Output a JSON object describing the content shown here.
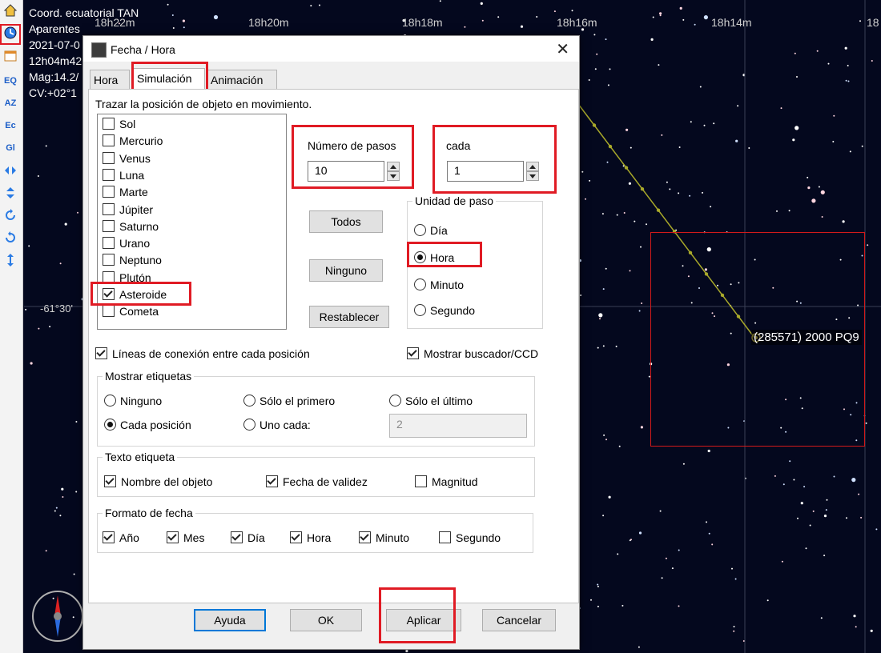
{
  "sky": {
    "info_lines": [
      "Coord. ecuatorial TAN",
      "Aparentes",
      "2021-07-0",
      "12h04m42",
      "Mag:14.2/",
      "CV:+02°1"
    ],
    "ra_labels": [
      "18h22m",
      "18h20m",
      "18h18m",
      "18h16m",
      "18h14m",
      "18"
    ],
    "dec_label": "-61°30'",
    "target_label": "(285571) 2000 PQ9"
  },
  "toolbar": {
    "buttons": [
      "EQ",
      "AZ",
      "Ec",
      "Gl"
    ]
  },
  "dialog": {
    "title": "Fecha / Hora",
    "close_symbol": "✕",
    "tabs": [
      "Hora",
      "Simulación",
      "Animación"
    ],
    "instruction": "Trazar la posición de objeto en movimiento.",
    "objects": [
      {
        "label": "Sol",
        "checked": false
      },
      {
        "label": "Mercurio",
        "checked": false
      },
      {
        "label": "Venus",
        "checked": false
      },
      {
        "label": "Luna",
        "checked": false
      },
      {
        "label": "Marte",
        "checked": false
      },
      {
        "label": "Júpiter",
        "checked": false
      },
      {
        "label": "Saturno",
        "checked": false
      },
      {
        "label": "Urano",
        "checked": false
      },
      {
        "label": "Neptuno",
        "checked": false
      },
      {
        "label": "Plutón",
        "checked": false
      },
      {
        "label": "Asteroide",
        "checked": true
      },
      {
        "label": "Cometa",
        "checked": false
      }
    ],
    "steps_label": "Número de pasos",
    "steps_value": "10",
    "every_label": "cada",
    "every_value": "1",
    "btn_all": "Todos",
    "btn_none": "Ninguno",
    "btn_reset": "Restablecer",
    "unit_group": "Unidad de paso",
    "units": [
      {
        "label": "Día",
        "selected": false
      },
      {
        "label": "Hora",
        "selected": true
      },
      {
        "label": "Minuto",
        "selected": false
      },
      {
        "label": "Segundo",
        "selected": false
      }
    ],
    "connect_lines": "Líneas de conexión entre cada posición",
    "show_finder": "Mostrar buscador/CCD",
    "labels_group": "Mostrar etiquetas",
    "label_opts": [
      {
        "label": "Ninguno",
        "selected": false
      },
      {
        "label": "Sólo el primero",
        "selected": false
      },
      {
        "label": "Sólo el último",
        "selected": false
      },
      {
        "label": "Cada posición",
        "selected": true
      },
      {
        "label": "Uno cada:",
        "selected": false
      }
    ],
    "uno_cada_value": "2",
    "text_group": "Texto etiqueta",
    "text_opts": [
      {
        "label": "Nombre del objeto",
        "checked": true
      },
      {
        "label": "Fecha de validez",
        "checked": true
      },
      {
        "label": "Magnitud",
        "checked": false
      }
    ],
    "date_group": "Formato de fecha",
    "date_opts": [
      {
        "label": "Año",
        "checked": true
      },
      {
        "label": "Mes",
        "checked": true
      },
      {
        "label": "Día",
        "checked": true
      },
      {
        "label": "Hora",
        "checked": true
      },
      {
        "label": "Minuto",
        "checked": true
      },
      {
        "label": "Segundo",
        "checked": false
      }
    ],
    "footer": {
      "help": "Ayuda",
      "ok": "OK",
      "apply": "Aplicar",
      "cancel": "Cancelar"
    }
  }
}
